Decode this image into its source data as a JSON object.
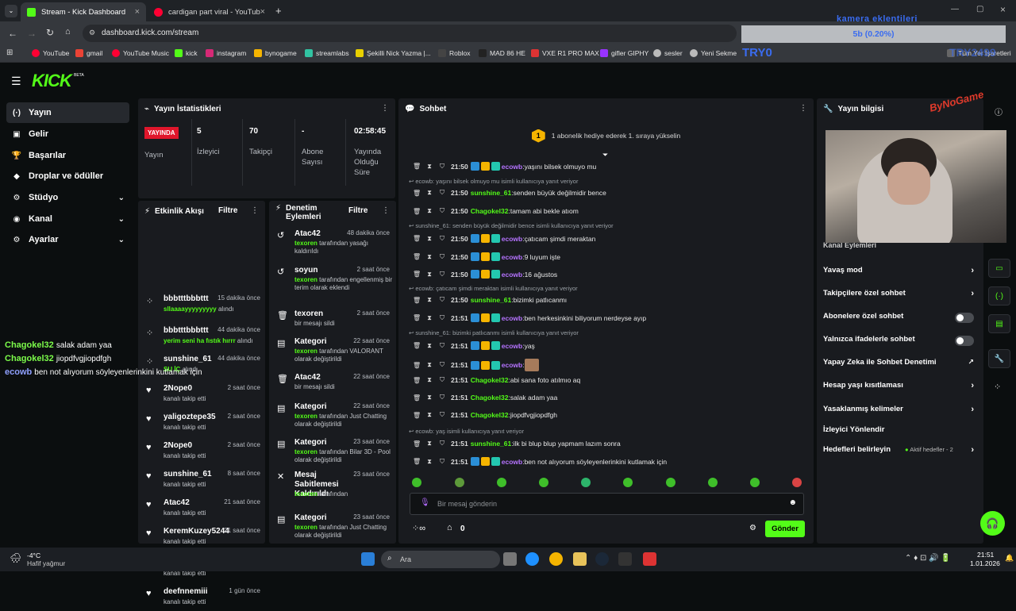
{
  "browser": {
    "tabs": [
      {
        "label": "Stream - Kick Dashboard"
      },
      {
        "label": "cardigan part viral - YouTub"
      }
    ],
    "url": "dashboard.kick.com/stream",
    "bookmarks": [
      "YouTube",
      "gmail",
      "YouTube Music",
      "kick",
      "instagram",
      "bynogame",
      "streamlabs",
      "Şekilli Nick Yazma |...",
      "Roblox",
      "MAD 86 HE",
      "VXE R1 PRO MAX",
      "gifler GIPHY",
      "sesler",
      "Yeni Sekme",
      "Tüm Yer İşaretleri"
    ]
  },
  "overlay": {
    "title": "kamera eklentileri",
    "progress": "5b (0.20%)",
    "tryo": "TRY0",
    "tryo2": "TRY2499",
    "chat": [
      {
        "user": "Chagokel32",
        "msg": "salak adam yaa"
      },
      {
        "user": "Chagokel32",
        "msg": "jiopdfvgjiopdfgh"
      },
      {
        "user": "ecowb",
        "msg": "ben not alıyorum söyleyenlerinkini kutlamak için"
      }
    ],
    "weather": {
      "temp": "-4°C",
      "desc": "Hafif yağmur"
    }
  },
  "nav": {
    "brand": "KICK",
    "beta": "BETA",
    "items": [
      {
        "label": "Yayın",
        "icon": "(·)"
      },
      {
        "label": "Gelir",
        "icon": "▣"
      },
      {
        "label": "Başarılar",
        "icon": "🏆"
      },
      {
        "label": "Droplar ve ödüller",
        "icon": "◆"
      },
      {
        "label": "Stüdyo",
        "icon": "⚙"
      },
      {
        "label": "Kanal",
        "icon": "◉"
      },
      {
        "label": "Ayarlar",
        "icon": "⚙"
      }
    ]
  },
  "stats": {
    "title": "Yayın İstatistikleri",
    "live": "YAYINDA",
    "live_label": "Yayın",
    "viewers": "5",
    "viewers_label": "İzleyici",
    "followers": "70",
    "followers_label": "Takipçi",
    "subs": "-",
    "subs_label": "Abone Sayısı",
    "duration": "02:58:45",
    "duration_label": "Yayında Olduğu Süre"
  },
  "activity": {
    "title": "Etkinlik Akışı",
    "filter": "Filtre",
    "rows": [
      {
        "name": "bbbtttbbbttt",
        "time": "15 dakika önce",
        "sub_green": "sllaaaayyyyyyyyy",
        "sub": " alındı",
        "icon": "gift"
      },
      {
        "name": "bbbtttbbbttt",
        "time": "44 dakika önce",
        "sub_green": "yerim seni ha fıstık hırrr",
        "sub": " alındı",
        "icon": "gift"
      },
      {
        "name": "sunshine_61",
        "time": "44 dakika önce",
        "sub_green": "SU İÇ",
        "sub": " alındı",
        "icon": "gift"
      },
      {
        "name": "2Nope0",
        "time": "2 saat önce",
        "sub_green": "",
        "sub": "kanalı takip etti",
        "icon": "heart"
      },
      {
        "name": "yaligoztepe35",
        "time": "2 saat önce",
        "sub_green": "",
        "sub": "kanalı takip etti",
        "icon": "heart"
      },
      {
        "name": "2Nope0",
        "time": "2 saat önce",
        "sub_green": "",
        "sub": "kanalı takip etti",
        "icon": "heart"
      },
      {
        "name": "sunshine_61",
        "time": "8 saat önce",
        "sub_green": "",
        "sub": "kanalı takip etti",
        "icon": "heart"
      },
      {
        "name": "Atac42",
        "time": "21 saat önce",
        "sub_green": "",
        "sub": "kanalı takip etti",
        "icon": "heart"
      },
      {
        "name": "KeremKuzey5244",
        "time": "21 saat önce",
        "sub_green": "",
        "sub": "kanalı takip etti",
        "icon": "heart"
      },
      {
        "name": "Atac42",
        "time": "22 saat önce",
        "sub_green": "",
        "sub": "kanalı takip etti",
        "icon": "heart"
      },
      {
        "name": "deefnnemiii",
        "time": "1 gün önce",
        "sub_green": "",
        "sub": "kanalı takip etti",
        "icon": "heart"
      }
    ]
  },
  "moderation": {
    "title": "Denetim Eylemleri",
    "filter": "Filtre",
    "rows": [
      {
        "name": "Atac42",
        "time": "48 dakika önce",
        "g": "texoren",
        "d": " tarafından yasağı kaldırıldı",
        "icon": "↺"
      },
      {
        "name": "soyun",
        "time": "2 saat önce",
        "g": "texoren",
        "d": " tarafından engellenmiş bir terim olarak eklendi",
        "icon": "↺"
      },
      {
        "name": "texoren",
        "time": "2 saat önce",
        "g": "",
        "d": "bir mesajı sildi",
        "icon": "🗑"
      },
      {
        "name": "Kategori",
        "time": "22 saat önce",
        "g": "texoren",
        "d": " tarafından VALORANT olarak değiştirildi",
        "icon": "▤"
      },
      {
        "name": "Atac42",
        "time": "22 saat önce",
        "g": "",
        "d": "bir mesajı sildi",
        "icon": "🗑"
      },
      {
        "name": "Kategori",
        "time": "22 saat önce",
        "g": "texoren",
        "d": " tarafından Just Chatting olarak değiştirildi",
        "icon": "▤"
      },
      {
        "name": "Kategori",
        "time": "23 saat önce",
        "g": "texoren",
        "d": " tarafından Bilar 3D - Pool olarak değiştirildi",
        "icon": "▤"
      },
      {
        "name": "Mesaj Sabitlemesi Kaldırıldı",
        "time": "23 saat önce",
        "g": "texoren",
        "d": " tarafından",
        "icon": "✕"
      },
      {
        "name": "Kategori",
        "time": "23 saat önce",
        "g": "texoren",
        "d": " tarafından Just Chatting olarak değiştirildi",
        "icon": "▤"
      }
    ]
  },
  "chat": {
    "title": "Sohbet",
    "banner": "1 abonelik hediye ederek 1. sıraya yükselin",
    "placeholder": "Bir mesaj gönderin",
    "points": "0",
    "send": "Gönder",
    "lines": [
      {
        "type": "msg",
        "time": "21:50",
        "user": "ecowb",
        "ucolor": "#b573ff",
        "badges": true,
        "text": "yaşını bilsek olmuyo mu"
      },
      {
        "type": "reply",
        "text": "ecowb: yaşını bilsek olmuyo mu isimli kullanıcıya yanıt veriyor"
      },
      {
        "type": "msg",
        "time": "21:50",
        "user": "sunshine_61",
        "ucolor": "#53fc18",
        "badges": false,
        "text": "senden büyük değilmidir bence"
      },
      {
        "type": "msg",
        "time": "21:50",
        "user": "Chagokel32",
        "ucolor": "#53fc18",
        "badges": false,
        "text": "tamam abi bekle atıom"
      },
      {
        "type": "reply",
        "text": "sunshine_61: senden büyük değilmidir bence isimli kullanıcıya yanıt veriyor"
      },
      {
        "type": "msg",
        "time": "21:50",
        "user": "ecowb",
        "ucolor": "#b573ff",
        "badges": true,
        "text": "çatıcam şimdi meraktan"
      },
      {
        "type": "msg",
        "time": "21:50",
        "user": "ecowb",
        "ucolor": "#b573ff",
        "badges": true,
        "text": "9 luyum işte"
      },
      {
        "type": "msg",
        "time": "21:50",
        "user": "ecowb",
        "ucolor": "#b573ff",
        "badges": true,
        "text": "16 ağustos"
      },
      {
        "type": "reply",
        "text": "ecowb: çatıcam şimdi meraktan isimli kullanıcıya yanıt veriyor"
      },
      {
        "type": "msg",
        "time": "21:50",
        "user": "sunshine_61",
        "ucolor": "#53fc18",
        "badges": false,
        "text": "bizimki patlıcanmı"
      },
      {
        "type": "msg",
        "time": "21:51",
        "user": "ecowb",
        "ucolor": "#b573ff",
        "badges": true,
        "text": "ben herkesinkini biliyorum nerdeyse ayıp"
      },
      {
        "type": "reply",
        "text": "sunshine_61: bizimki patlıcanmı isimli kullanıcıya yanıt veriyor"
      },
      {
        "type": "msg",
        "time": "21:51",
        "user": "ecowb",
        "ucolor": "#b573ff",
        "badges": true,
        "text": "yaş"
      },
      {
        "type": "msg",
        "time": "21:51",
        "user": "ecowb",
        "ucolor": "#b573ff",
        "badges": true,
        "text": "",
        "emote": true
      },
      {
        "type": "msg",
        "time": "21:51",
        "user": "Chagokel32",
        "ucolor": "#53fc18",
        "badges": false,
        "text": "abi sana foto atılmıo aq"
      },
      {
        "type": "msg",
        "time": "21:51",
        "user": "Chagokel32",
        "ucolor": "#53fc18",
        "badges": false,
        "text": "salak adam yaa"
      },
      {
        "type": "msg",
        "time": "21:51",
        "user": "Chagokel32",
        "ucolor": "#53fc18",
        "badges": false,
        "text": "jiopdfvgjiopdfgh"
      },
      {
        "type": "reply",
        "text": "ecowb: yaş isimli kullanıcıya yanıt veriyor"
      },
      {
        "type": "msg",
        "time": "21:51",
        "user": "sunshine_61",
        "ucolor": "#53fc18",
        "badges": false,
        "text": "ilk bi blup blup yapmam lazım sonra"
      },
      {
        "type": "msg",
        "time": "21:51",
        "user": "ecowb",
        "ucolor": "#b573ff",
        "badges": true,
        "text": "ben not alıyorum söyleyenlerinkini kutlamak için"
      }
    ]
  },
  "info": {
    "title": "Yayın bilgisi",
    "hidden_row": "Kanal Eylemleri",
    "rows": [
      {
        "label": "Yavaş mod",
        "ctrl": "chev"
      },
      {
        "label": "Takipçilere özel sohbet",
        "ctrl": "chev"
      },
      {
        "label": "Abonelere özel sohbet",
        "ctrl": "toggle"
      },
      {
        "label": "Yalnızca ifadelerle sohbet",
        "ctrl": "toggle"
      },
      {
        "label": "Yapay Zeka ile Sohbet Denetimi",
        "ctrl": "ext"
      },
      {
        "label": "Hesap yaşı kısıtlaması",
        "ctrl": "chev"
      },
      {
        "label": "Yasaklanmış kelimeler",
        "ctrl": "chev"
      },
      {
        "label": "İzleyici Yönlendir",
        "ctrl": "none"
      },
      {
        "label": "Hedefleri belirleyin",
        "ctrl": "goal"
      }
    ],
    "goal_status": "Aktif hedefler - 2"
  },
  "taskbar": {
    "search": "Ara",
    "time": "21:51",
    "date": "1.01.2026"
  },
  "colors": {
    "accent": "#53fc18",
    "bg": "#0b0e0f",
    "panel": "#191b1f",
    "live": "#e0162b"
  }
}
